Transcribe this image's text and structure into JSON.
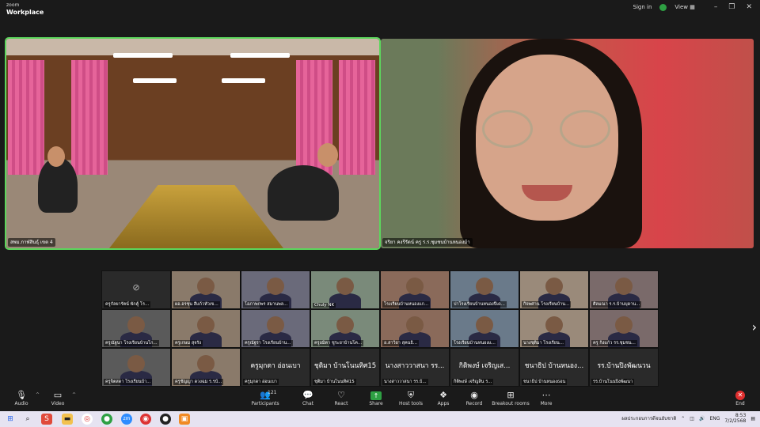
{
  "app": {
    "brand_small": "zoom",
    "brand": "Workplace"
  },
  "topbar": {
    "sign_in": "Sign in",
    "view": "View",
    "icons": [
      "shield-check-icon",
      "grid-view-icon",
      "minimize-icon",
      "restore-icon",
      "close-icon"
    ]
  },
  "main_tiles": [
    {
      "name": "สพม.กาฬสินธุ์ เขต 4"
    },
    {
      "name": "จริยา คงรีรัตน์ ครู ร.ร.ชุมชนบ้านหนองม้า"
    }
  ],
  "gallery": [
    {
      "name": "ครูกัลยารัตน์ พักคู้ โร...",
      "video": false
    },
    {
      "name": "ผอ.อรชุน สีแก้วหัวเข...",
      "video": true
    },
    {
      "name": "โอภาพกพร สมานพล...",
      "video": true
    },
    {
      "name": "Chuly NK",
      "video": true
    },
    {
      "name": "โรงเรียนบ้านหนองแก...",
      "video": true
    },
    {
      "name": "ปาโรงเรียนบ้านหนองปีเด...",
      "video": true
    },
    {
      "name": "กิจพศาน โรงเรียนบ้าน...",
      "video": true
    },
    {
      "name": "ศิลมณา ร.ร.บ้านบุดาน...",
      "video": true
    },
    {
      "name": "ครูณัฐนา โรงเรียนบ้านโก...",
      "video": true
    },
    {
      "name": "ครูเกษม สุจรัง",
      "video": true
    },
    {
      "name": "ครูณัฐรา โรงเรียนบ้าน...",
      "video": true
    },
    {
      "name": "ครูอมิตา ชูระยาบ้านโค...",
      "video": true
    },
    {
      "name": "อ.สาวิยา สุคนธิ...",
      "video": true
    },
    {
      "name": "โรงเรียนบ้านหนองแ...",
      "video": true
    },
    {
      "name": "นางชุติมา โรงเรียน...",
      "video": true
    },
    {
      "name": "ครู กิ่งแก้ว รร.ชุมชน...",
      "video": true
    },
    {
      "name": "ครูจิตสดา โรงเรียนบ้า...",
      "video": true
    },
    {
      "name": "ครูชัญญา ดวงฉม ร.รบ้...",
      "video": true
    },
    {
      "name": "ครูมุกดา อ่อนเบา",
      "video": false,
      "display": "ครูมุกดา อ่อนเบา"
    },
    {
      "name": "ชุติมา บ้านโนนทิศ15",
      "video": false,
      "display": "ชุติมา บ้านโนนทิศ15"
    },
    {
      "name": "นางสาววาสนา รร.บ้...",
      "video": false,
      "display": "นางสาววาสนา รร..."
    },
    {
      "name": "กิติพงษ์ เจริญสิน ร...",
      "video": false,
      "display": "กิติพงษ์ เจริญเส..."
    },
    {
      "name": "ชนาธิป บ้านหนองธอน",
      "video": false,
      "display": "ชนาธิป บ้านหนอง..."
    },
    {
      "name": "รร.บ้านโนนปิงพัฒนา",
      "video": false,
      "display": "รร.บ้านปิงพัฒนวน"
    }
  ],
  "toolbar": {
    "audio": "Audio",
    "video": "Video",
    "participants": "Participants",
    "participants_count": "121",
    "chat": "Chat",
    "react": "React",
    "share": "Share",
    "host_tools": "Host tools",
    "apps": "Apps",
    "record": "Record",
    "breakout": "Breakout rooms",
    "more": "More",
    "end": "End"
  },
  "taskbar": {
    "news": "ผลประกอบการดีจนยับชาติ",
    "lang": "ENG",
    "time": "8:53",
    "date": "7/2/2568"
  },
  "colors": {
    "active_speaker": "#5cd65c",
    "end": "#e02f2f",
    "share": "#2ea043"
  }
}
